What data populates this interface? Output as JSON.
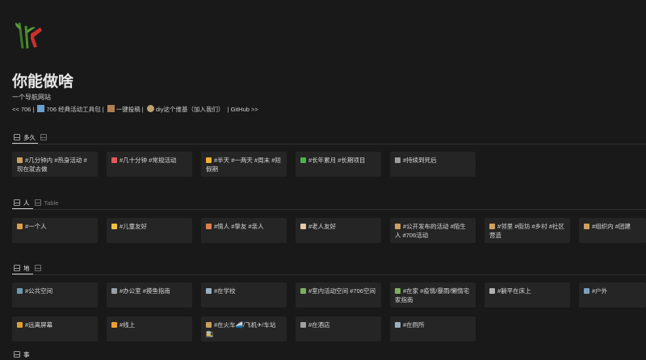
{
  "page": {
    "title": "你能做啥",
    "subtitle": "一个导航网站",
    "nav": {
      "back": "<< 706 |",
      "toolkit": "706 经典活动工具包 |",
      "submit": "一键投稿 |",
      "diy": "diy这个维基（加入我们）",
      "github": "| GitHub >>"
    }
  },
  "sections": [
    {
      "id": "duration",
      "tabs": [
        {
          "label": "多久",
          "active": true
        },
        {
          "label": "",
          "active": false
        }
      ],
      "cards": [
        {
          "emoji_color": "#c9a25a",
          "text": "#几分钟内 #热身活动 #现在就去做"
        },
        {
          "emoji_color": "#e05a5a",
          "text": "#几十分钟 #常规活动"
        },
        {
          "emoji_color": "#f0b030",
          "text": "#半天 #一两天 #周末 #短假期"
        },
        {
          "emoji_color": "#4caf50",
          "text": "#长年累月 #长期项目"
        },
        {
          "emoji_color": "#9e9e9e",
          "text": "#持续到死后"
        }
      ]
    },
    {
      "id": "people",
      "tabs": [
        {
          "label": "人",
          "active": true
        },
        {
          "label": "Table",
          "active": false
        }
      ],
      "cards": [
        {
          "emoji_color": "#e0a040",
          "text": "#一个人"
        },
        {
          "emoji_color": "#f0c040",
          "text": "#儿童友好"
        },
        {
          "emoji_color": "#e08050",
          "text": "#情人 #挚友 #亲人"
        },
        {
          "emoji_color": "#e8c8a8",
          "text": "#老人友好"
        },
        {
          "emoji_color": "#d0a060",
          "text": "#公开发布的活动 #陌生人 #706活动"
        },
        {
          "emoji_color": "#d0a060",
          "text": "#邻里 #街坊 #乡村 #社区营造"
        },
        {
          "emoji_color": "#d0a060",
          "text": "#组织内 #团建"
        }
      ]
    },
    {
      "id": "place",
      "tabs": [
        {
          "label": "地",
          "active": true
        },
        {
          "label": "",
          "active": false
        }
      ],
      "cards": [
        {
          "emoji_color": "#6a9ab0",
          "text": "#公共空间"
        },
        {
          "emoji_color": "#9aa0a8",
          "text": "#办公室 #摸鱼指南"
        },
        {
          "emoji_color": "#9ab0c0",
          "text": "#在学校"
        },
        {
          "emoji_color": "#7cb060",
          "text": "#室内活动空间 #706空间"
        },
        {
          "emoji_color": "#7cb060",
          "text": "#在家 #疫情/暴雨/懒惰宅家指南"
        },
        {
          "emoji_color": "#b0b0b0",
          "text": "#躺平在床上"
        },
        {
          "emoji_color": "#7aa0c0",
          "text": "#户外"
        },
        {
          "emoji_color": "#e0a030",
          "text": "#远离屏幕"
        },
        {
          "emoji_color": "#f0a030",
          "text": "#线上"
        },
        {
          "emoji_color": "#c9a25a",
          "text": "#在火车🚄/飞机✈/车站🚉"
        },
        {
          "emoji_color": "#a0a0a0",
          "text": "#在酒店"
        },
        {
          "emoji_color": "#9ab0c0",
          "text": "#在厕所"
        }
      ]
    }
  ],
  "cut_off_heading": "事"
}
